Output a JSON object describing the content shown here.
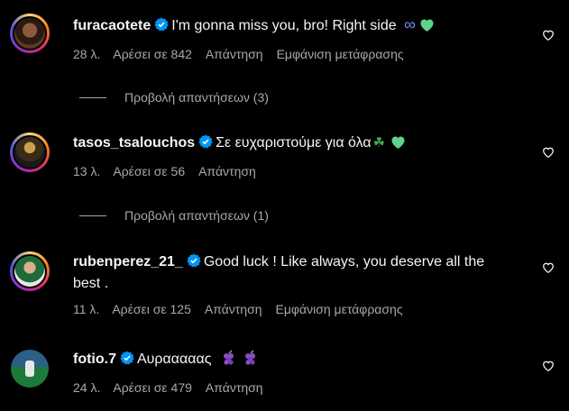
{
  "comments": [
    {
      "username": "furacaotete",
      "text": "I'm gonna miss you, bro! Right side",
      "time": "28 λ.",
      "likes": "Αρέσει σε 842",
      "reply": "Απάντηση",
      "translate": "Εμφάνιση μετάφρασης"
    },
    {
      "username": "tasos_tsalouchos",
      "text": "Σε ευχαριστούμε για όλα",
      "time": "13 λ.",
      "likes": "Αρέσει σε 56",
      "reply": "Απάντηση"
    },
    {
      "username": "rubenperez_21_",
      "text": "Good luck ! Like always, you deserve all the",
      "text2": "best .",
      "time": "11 λ.",
      "likes": "Αρέσει σε 125",
      "reply": "Απάντηση",
      "translate": "Εμφάνιση μετάφρασης"
    },
    {
      "username": "fotio.7",
      "text": "Αυρααααας",
      "time": "24 λ.",
      "likes": "Αρέσει σε 479",
      "reply": "Απάντηση"
    }
  ],
  "replies": [
    {
      "label": "Προβολή απαντήσεων (3)"
    },
    {
      "label": "Προβολή απαντήσεων (1)"
    }
  ],
  "colors": {
    "background": "#000000",
    "text": "#f5f5f5",
    "secondary": "#a8a8a8",
    "verified": "#0095f6",
    "green_heart": "#5fd38d"
  }
}
